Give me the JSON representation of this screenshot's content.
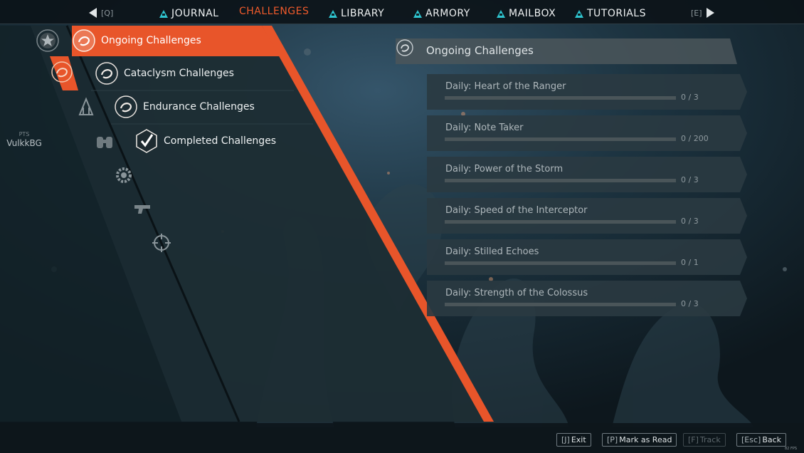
{
  "nav": {
    "prev_key": "[Q]",
    "next_key": "[E]",
    "tabs": [
      {
        "label": "JOURNAL",
        "icon": "triangle-icon",
        "active": false
      },
      {
        "label": "CHALLENGES",
        "icon": "",
        "active": true
      },
      {
        "label": "LIBRARY",
        "icon": "triangle-icon",
        "active": false
      },
      {
        "label": "ARMORY",
        "icon": "triangle-icon",
        "active": false
      },
      {
        "label": "MAILBOX",
        "icon": "triangle-icon",
        "active": false
      },
      {
        "label": "TUTORIALS",
        "icon": "triangle-icon",
        "active": false
      }
    ]
  },
  "player": {
    "pts_label": "PTS",
    "name": "VulkkBG"
  },
  "categories": {
    "items": [
      {
        "label": "Ongoing Challenges",
        "icon": "swirl-emblem-icon",
        "selected": true
      },
      {
        "label": "Cataclysm Challenges",
        "icon": "swirl-emblem-icon",
        "selected": false
      },
      {
        "label": "Endurance Challenges",
        "icon": "swirl-emblem-icon",
        "selected": false
      },
      {
        "label": "Completed Challenges",
        "icon": "checkmark-icon",
        "selected": false
      }
    ],
    "rail_icons": [
      "star-emblem-icon",
      "swirl-emblem-icon",
      "javelin-icon",
      "binoculars-icon",
      "gear-icon",
      "weapon-icon",
      "crosshair-icon"
    ]
  },
  "section": {
    "title": "Ongoing Challenges",
    "icon": "swirl-emblem-icon"
  },
  "challenges": [
    {
      "name": "Daily: Heart of the Ranger",
      "progress": "0 / 3",
      "fraction": 0
    },
    {
      "name": "Daily: Note Taker",
      "progress": "0 / 200",
      "fraction": 0
    },
    {
      "name": "Daily: Power of the Storm",
      "progress": "0 / 3",
      "fraction": 0
    },
    {
      "name": "Daily: Speed of the Interceptor",
      "progress": "0 / 3",
      "fraction": 0
    },
    {
      "name": "Daily: Stilled Echoes",
      "progress": "0 / 1",
      "fraction": 0
    },
    {
      "name": "Daily: Strength of the Colossus",
      "progress": "0 / 3",
      "fraction": 0
    }
  ],
  "actions": [
    {
      "key": "[J]",
      "label": "Exit",
      "enabled": true
    },
    {
      "key": "[P]",
      "label": "Mark as Read",
      "enabled": true
    },
    {
      "key": "[F]",
      "label": "Track",
      "enabled": false
    },
    {
      "key": "[Esc]",
      "label": "Back",
      "enabled": true
    }
  ],
  "fps": "82 FPS",
  "colors": {
    "accent": "#e8552a",
    "tab_active": "#ee5a2b",
    "nav_icon": "#2ec4cf",
    "panel": "#1d2d34",
    "background": "#1a2c35"
  }
}
